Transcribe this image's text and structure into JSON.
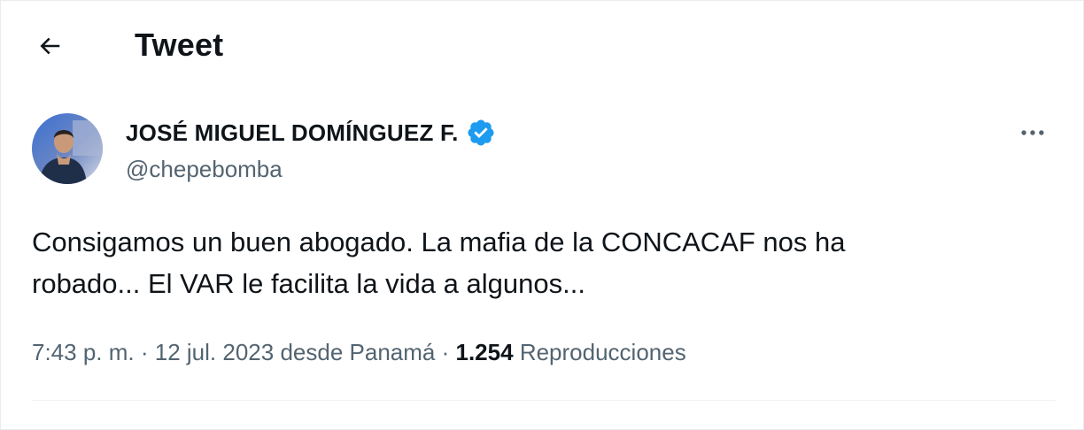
{
  "header": {
    "title": "Tweet",
    "back_icon": "arrow-left-icon"
  },
  "author": {
    "name": "JOSÉ MIGUEL DOMÍNGUEZ F.",
    "handle": "@chepebomba",
    "verified": true,
    "verified_color": "#1d9bf0",
    "avatar_icon": "profile-photo"
  },
  "more_icon": "more-horizontal-icon",
  "tweet": {
    "text_line1": "Consigamos un buen abogado. La mafia de la CONCACAF nos ha",
    "text_line2": "robado... El VAR le facilita la vida a algunos...",
    "time": "7:43 p. m.",
    "separator": "·",
    "date": "12 jul. 2023",
    "location": "desde Panamá",
    "views_count": "1.254",
    "views_label": "Reproducciones"
  },
  "colors": {
    "text_primary": "#0f1419",
    "text_secondary": "#536471",
    "accent": "#1d9bf0",
    "divider": "#eff3f4"
  }
}
